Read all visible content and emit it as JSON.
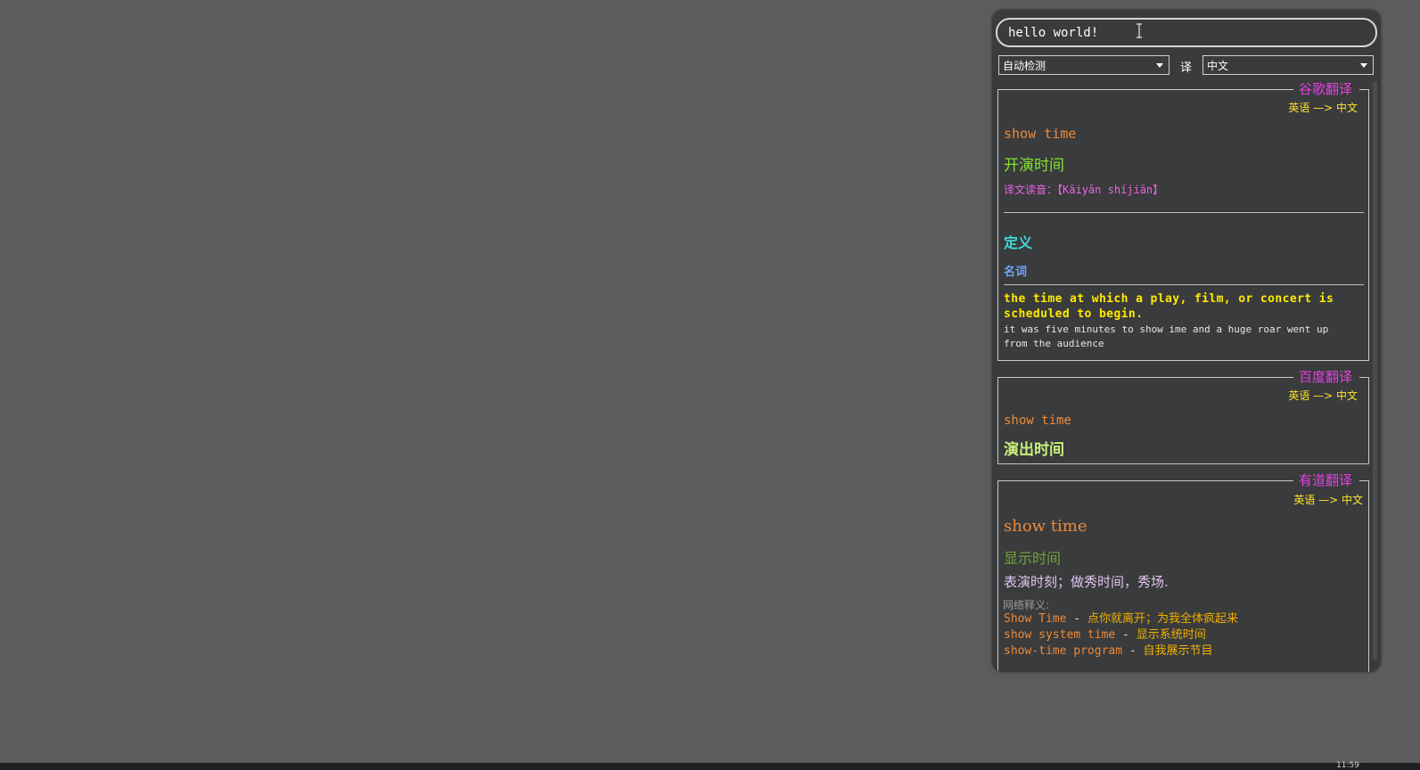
{
  "search": {
    "value": "hello world!"
  },
  "languages": {
    "from": "自动检测",
    "translate_label": "译",
    "to": "中文"
  },
  "google": {
    "title": "谷歌翻译",
    "direction": "英语 —> 中文",
    "source": "show time",
    "translation": "开演时间",
    "pinyin_label": "译文读音：",
    "pinyin": "【Kāiyǎn shíjiān】",
    "definition_heading": "定义",
    "pos": "名词",
    "definition": "the time at which a play, film, or concert is scheduled to begin.",
    "example": "it was five minutes to show ime and a huge roar went up from the audience"
  },
  "baidu": {
    "title": "百度翻译",
    "direction": "英语 —> 中文",
    "source": "show time",
    "translation": "演出时间"
  },
  "youdao": {
    "title": "有道翻译",
    "direction": "英语 —> 中文",
    "source": "show time",
    "translation": "显示时间",
    "meaning": "表演时刻；做秀时间，秀场.",
    "web_label": "网络释义:",
    "web": [
      {
        "term": "Show Time",
        "sep": " - ",
        "meaning": "点你就离开；为我全体疯起来"
      },
      {
        "term": "show system time",
        "sep": " - ",
        "meaning": "显示系统时间"
      },
      {
        "term": "show-time program",
        "sep": " - ",
        "meaning": "自我展示节目"
      }
    ]
  },
  "taskbar": {
    "clock": "11:59"
  },
  "colors": {
    "background": "#5b5c5b",
    "panel": "#3a3b3c",
    "title_magenta": "#e23fe3",
    "direction_yellow": "#ffe32a",
    "source_orange": "#ec8a3a",
    "translation_green": "#82e232",
    "pinyin_pink": "#ee62e6",
    "heading_cyan": "#40d8d8",
    "pos_blue": "#6ea4f2",
    "definition_yellow": "#ffea00"
  }
}
